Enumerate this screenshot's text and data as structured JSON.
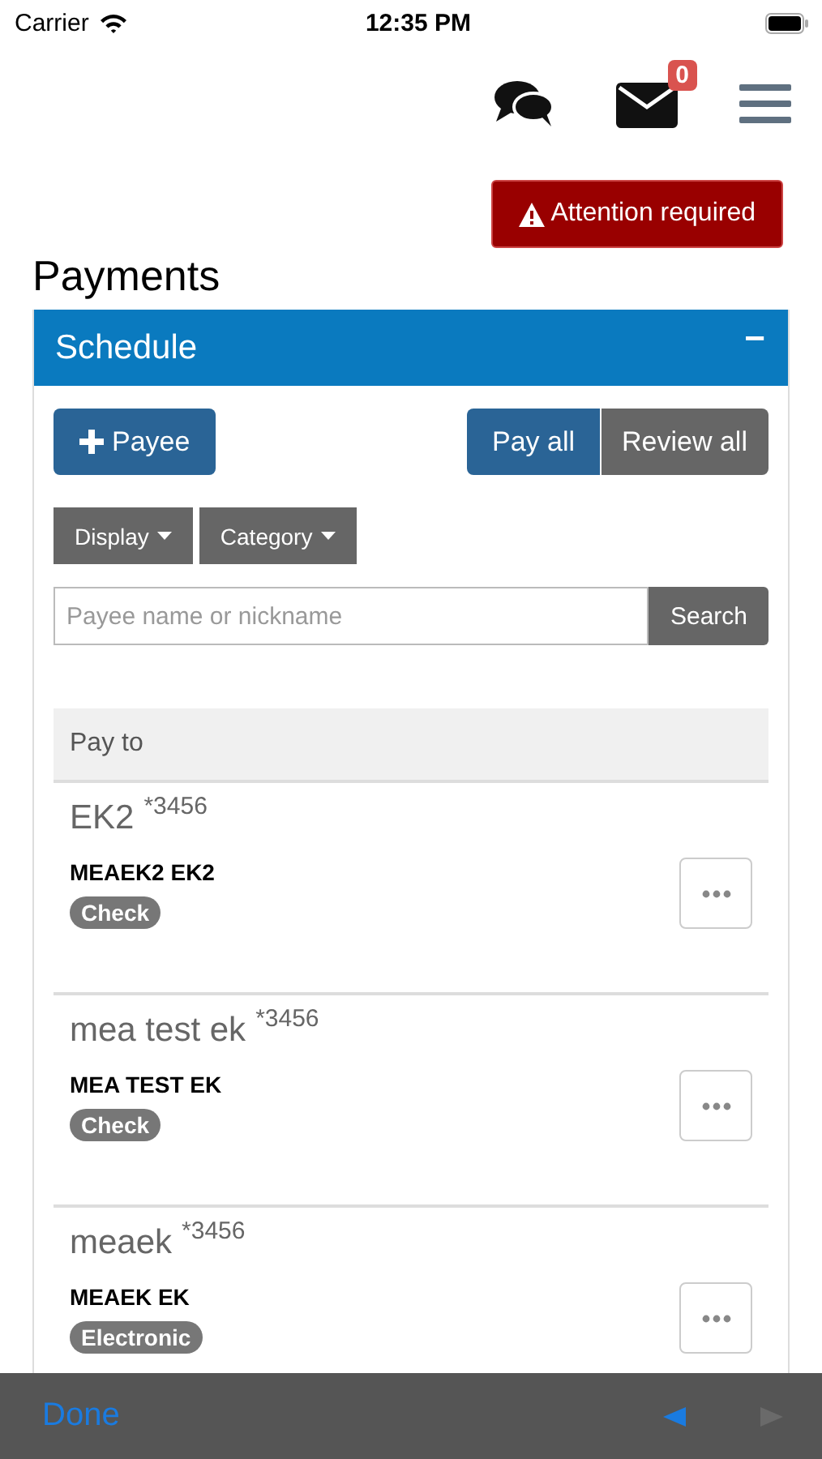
{
  "status_bar": {
    "carrier": "Carrier",
    "time": "12:35 PM"
  },
  "header": {
    "mail_badge": "0"
  },
  "alert": {
    "label": "Attention required"
  },
  "page_title": "Payments",
  "panel": {
    "title": "Schedule",
    "toggle": "−"
  },
  "actions": {
    "add": "Payee",
    "pay_all": "Pay all",
    "review_all": "Review all"
  },
  "filters": [
    {
      "label": "Display"
    },
    {
      "label": "Category"
    }
  ],
  "search": {
    "placeholder": "Payee name or nickname",
    "button": "Search"
  },
  "list_header": "Pay to",
  "payees": [
    {
      "nickname": "EK2",
      "account": "*3456",
      "name": "MEAEK2 EK2",
      "method": "Check"
    },
    {
      "nickname": "mea test ek",
      "account": "*3456",
      "name": "MEA TEST EK",
      "method": "Check"
    },
    {
      "nickname": "meaek",
      "account": "*3456",
      "name": "MEAEK EK",
      "method": "Electronic"
    }
  ],
  "toolbar": {
    "done": "Done",
    "nav": [
      {
        "kind": "previous",
        "disabled": false
      },
      {
        "kind": "next",
        "disabled": true
      }
    ]
  }
}
